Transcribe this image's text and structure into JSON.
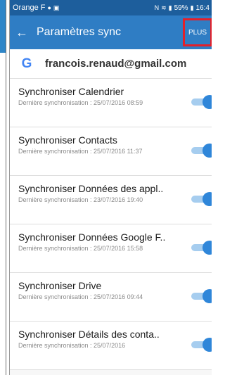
{
  "status_bar": {
    "carrier": "Orange F",
    "right_text": "59%",
    "time": "16:4"
  },
  "header": {
    "back_icon": "arrow-left-icon",
    "title": "Paramètres sync",
    "more_label": "PLUS"
  },
  "account": {
    "logo_letter": "G",
    "email": "francois.renaud@gmail.com"
  },
  "sync_items": [
    {
      "title": "Synchroniser Calendrier",
      "subtitle": "Dernière synchronisation : 25/07/2016 08:59",
      "enabled": true
    },
    {
      "title": "Synchroniser Contacts",
      "subtitle": "Dernière synchronisation : 25/07/2016 11:37",
      "enabled": true
    },
    {
      "title": "Synchroniser Données des appl..",
      "subtitle": "Dernière synchronisation : 23/07/2016 19:40",
      "enabled": true
    },
    {
      "title": "Synchroniser Données Google F..",
      "subtitle": "Dernière synchronisation : 25/07/2016 15:58",
      "enabled": true
    },
    {
      "title": "Synchroniser Drive",
      "subtitle": "Dernière synchronisation : 25/07/2016 09:44",
      "enabled": true
    },
    {
      "title": "Synchroniser Détails des conta..",
      "subtitle": "Dernière synchronisation : 25/07/2016",
      "enabled": true
    }
  ],
  "colors": {
    "status_bar": "#1d5e9c",
    "app_bar": "#2f7dc4",
    "highlight_box": "#e3202a",
    "toggle_on": "#2f86d9"
  }
}
